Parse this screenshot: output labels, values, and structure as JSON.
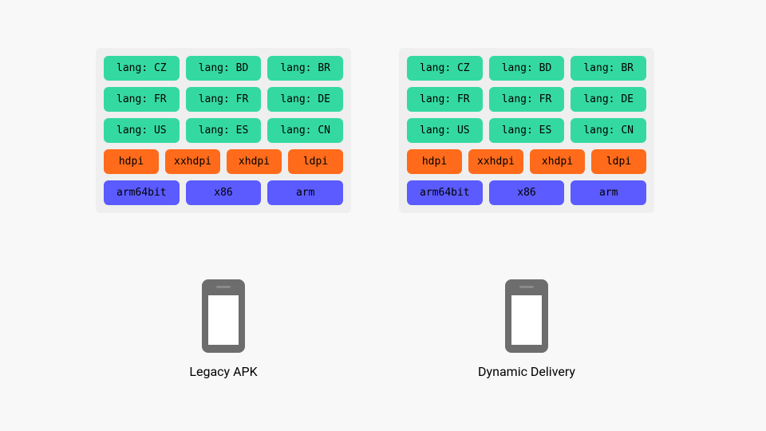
{
  "colors": {
    "lang": "#34d9a2",
    "dpi": "#ff6b1a",
    "abi": "#5b5bff",
    "panel": "#efefef",
    "page_bg": "#f8f8f8",
    "phone": "#6d6d6d"
  },
  "bundle": {
    "lang_rows": [
      [
        "lang: CZ",
        "lang: BD",
        "lang: BR"
      ],
      [
        "lang: FR",
        "lang: FR",
        "lang: DE"
      ],
      [
        "lang: US",
        "lang: ES",
        "lang: CN"
      ]
    ],
    "dpi_row": [
      "hdpi",
      "xxhdpi",
      "xhdpi",
      "ldpi"
    ],
    "abi_row": [
      "arm64bit",
      "x86",
      "arm"
    ]
  },
  "left": {
    "caption": "Legacy APK"
  },
  "right": {
    "caption": "Dynamic Delivery"
  }
}
